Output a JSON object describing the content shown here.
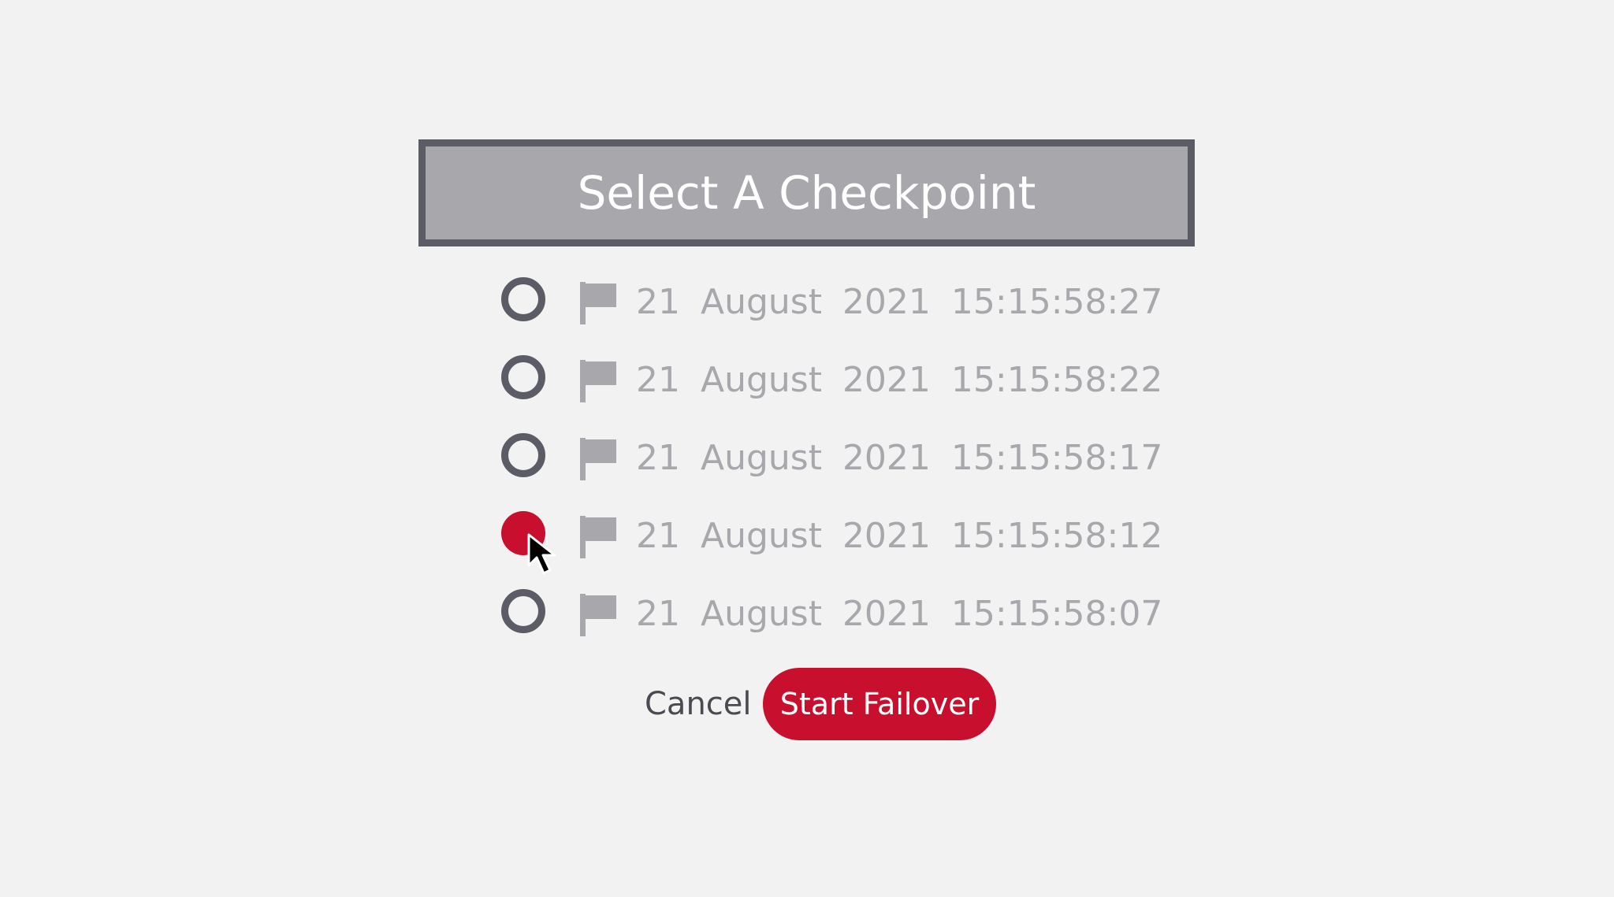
{
  "dialog": {
    "title": "Select A Checkpoint"
  },
  "checkpoints": [
    {
      "label": "21 August 2021 15:15:58:27",
      "selected": false
    },
    {
      "label": "21 August 2021 15:15:58:22",
      "selected": false
    },
    {
      "label": "21 August 2021 15:15:58:17",
      "selected": false
    },
    {
      "label": "21 August 2021 15:15:58:12",
      "selected": true
    },
    {
      "label": "21 August 2021 15:15:58:07",
      "selected": false
    }
  ],
  "actions": {
    "cancel_label": "Cancel",
    "start_label": "Start Failover"
  },
  "icons": {
    "checkpoint_icon": "flag-icon",
    "pointer": "mouse-cursor-icon"
  },
  "colors": {
    "accent": "#c8102e",
    "title_bar": "#a7a7ac",
    "title_border": "#5c5c66",
    "radio_border": "#5c5c66",
    "label_text": "#a7a7ac",
    "flag": "#a7a7ac",
    "background": "#f2f2f3"
  }
}
